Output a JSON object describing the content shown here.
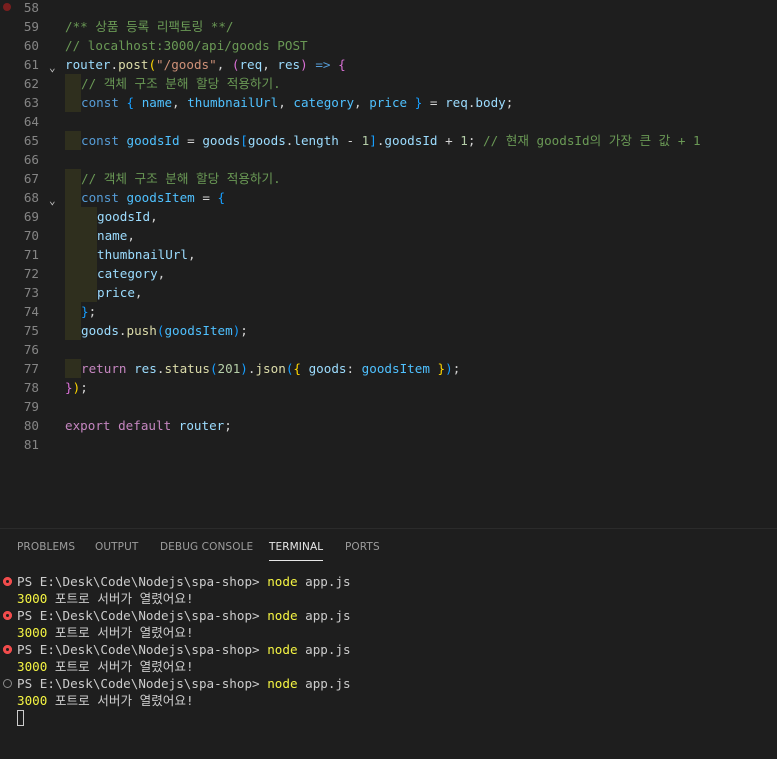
{
  "editor": {
    "lines": {
      "l58": "58",
      "l59": "59",
      "l60": "60",
      "l61": "61",
      "l62": "62",
      "l63": "63",
      "l64": "64",
      "l65": "65",
      "l66": "66",
      "l67": "67",
      "l68": "68",
      "l69": "69",
      "l70": "70",
      "l71": "71",
      "l72": "72",
      "l73": "73",
      "l74": "74",
      "l75": "75",
      "l76": "76",
      "l77": "77",
      "l78": "78",
      "l79": "79",
      "l80": "80",
      "l81": "81"
    },
    "code": {
      "c59": "/** 상품 등록 리팩토링 **/",
      "c60": "// localhost:3000/api/goods POST",
      "c61": {
        "a": "router",
        "b": ".",
        "c": "post",
        "d": "(",
        "e": "\"/goods\"",
        "f": ", ",
        "g": "(",
        "h": "req",
        "i": ", ",
        "j": "res",
        "k": ")",
        "l": " => ",
        "m": "{"
      },
      "c62": "// 객체 구조 분해 할당 적용하기.",
      "c63": {
        "a": "const",
        "b": " ",
        "c": "{",
        "d": " name",
        "e": ", ",
        "f": "thumbnailUrl",
        "g": ", ",
        "h": "category",
        "i": ", ",
        "j": "price",
        "k": " }",
        "l": " = ",
        "m": "req",
        "n": ".",
        "o": "body",
        "p": ";"
      },
      "c65": {
        "a": "const",
        "b": " ",
        "c": "goodsId",
        "d": " = ",
        "e": "goods",
        "f": "[",
        "g": "goods",
        "h": ".",
        "i": "length",
        "j": " - ",
        "k": "1",
        "l": "]",
        "m": ".",
        "n": "goodsId",
        "o": " + ",
        "p": "1",
        "q": "; ",
        "r": "// 현재 goodsId의 가장 큰 값 + 1"
      },
      "c67": "// 객체 구조 분해 할당 적용하기.",
      "c68": {
        "a": "const",
        "b": " ",
        "c": "goodsItem",
        "d": " = ",
        "e": "{"
      },
      "c69": {
        "a": "goodsId",
        "b": ","
      },
      "c70": {
        "a": "name",
        "b": ","
      },
      "c71": {
        "a": "thumbnailUrl",
        "b": ","
      },
      "c72": {
        "a": "category",
        "b": ","
      },
      "c73": {
        "a": "price",
        "b": ","
      },
      "c74": {
        "a": "}",
        "b": ";"
      },
      "c75": {
        "a": "goods",
        "b": ".",
        "c": "push",
        "d": "(",
        "e": "goodsItem",
        "f": ")",
        "g": ";"
      },
      "c77": {
        "a": "return",
        "b": " ",
        "c": "res",
        "d": ".",
        "e": "status",
        "f": "(",
        "g": "201",
        "h": ")",
        "i": ".",
        "j": "json",
        "k": "(",
        "l": "{",
        "m": " goods",
        "n": ": ",
        "o": "goodsItem",
        "p": " }",
        "q": ")",
        "r": ";"
      },
      "c78": {
        "a": "}",
        "b": ")",
        "c": ";"
      },
      "c80": {
        "a": "export",
        "b": " ",
        "c": "default",
        "d": " ",
        "e": "router",
        "f": ";"
      }
    }
  },
  "panel": {
    "tabs": [
      "PROBLEMS",
      "OUTPUT",
      "DEBUG CONSOLE",
      "TERMINAL",
      "PORTS"
    ],
    "active_tab": "TERMINAL",
    "terminal": [
      {
        "prompt": "PS E:\\Desk\\Code\\Nodejs\\spa-shop> ",
        "cmd": "node",
        "arg": " app.js",
        "status": "error",
        "out_num": "3000",
        "out_text": " 포트로 서버가 열렸어요!"
      },
      {
        "prompt": "PS E:\\Desk\\Code\\Nodejs\\spa-shop> ",
        "cmd": "node",
        "arg": " app.js",
        "status": "error",
        "out_num": "3000",
        "out_text": " 포트로 서버가 열렸어요!"
      },
      {
        "prompt": "PS E:\\Desk\\Code\\Nodejs\\spa-shop> ",
        "cmd": "node",
        "arg": " app.js",
        "status": "error",
        "out_num": "3000",
        "out_text": " 포트로 서버가 열렸어요!"
      },
      {
        "prompt": "PS E:\\Desk\\Code\\Nodejs\\spa-shop> ",
        "cmd": "node",
        "arg": " app.js",
        "status": "neutral",
        "out_num": "3000",
        "out_text": " 포트로 서버가 열렸어요!"
      }
    ]
  },
  "colors": {
    "comment": "#6a9955",
    "function": "#dcdcaa",
    "variable": "#9cdcfe",
    "constant": "#4fc1ff",
    "keyword": "#569cd6",
    "control": "#c586c0",
    "string": "#ce9178",
    "number": "#b5cea8",
    "bracket1": "#ffd700",
    "bracket2": "#da70d6",
    "bracket3": "#179fff"
  }
}
